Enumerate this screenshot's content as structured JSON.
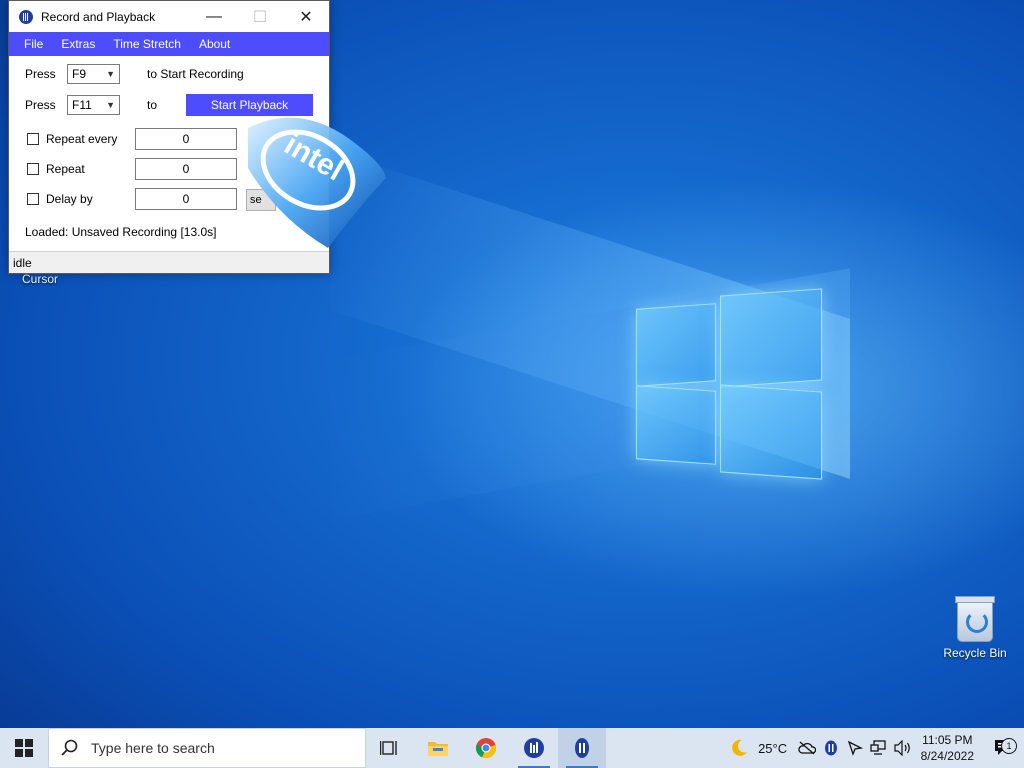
{
  "window": {
    "title": "Record and Playback",
    "minimize": "—",
    "maximize": "☐",
    "close": "✕"
  },
  "menu": [
    "File",
    "Extras",
    "Time Stretch",
    "About"
  ],
  "form": {
    "press_label": "Press",
    "record_key": "F9",
    "record_text": "to Start Recording",
    "play_key": "F11",
    "to_text": "to",
    "play_button": "Start Playback",
    "repeat_every_label": "Repeat every",
    "repeat_every_value": "0",
    "repeat_label": "Repeat",
    "repeat_value": "0",
    "delay_label": "Delay by",
    "delay_value": "0",
    "delay_unit_button": "se",
    "loaded_text": "Loaded:  Unsaved Recording [13.0s]"
  },
  "status": "idle",
  "desktop": {
    "cursor_label": "Cursor",
    "recycle_bin_label": "Recycle Bin",
    "watermark_text": "intel"
  },
  "taskbar": {
    "search_placeholder": "Type here to search",
    "weather": "25°C",
    "time": "11:05 PM",
    "date": "8/24/2022",
    "notification_count": "1"
  }
}
